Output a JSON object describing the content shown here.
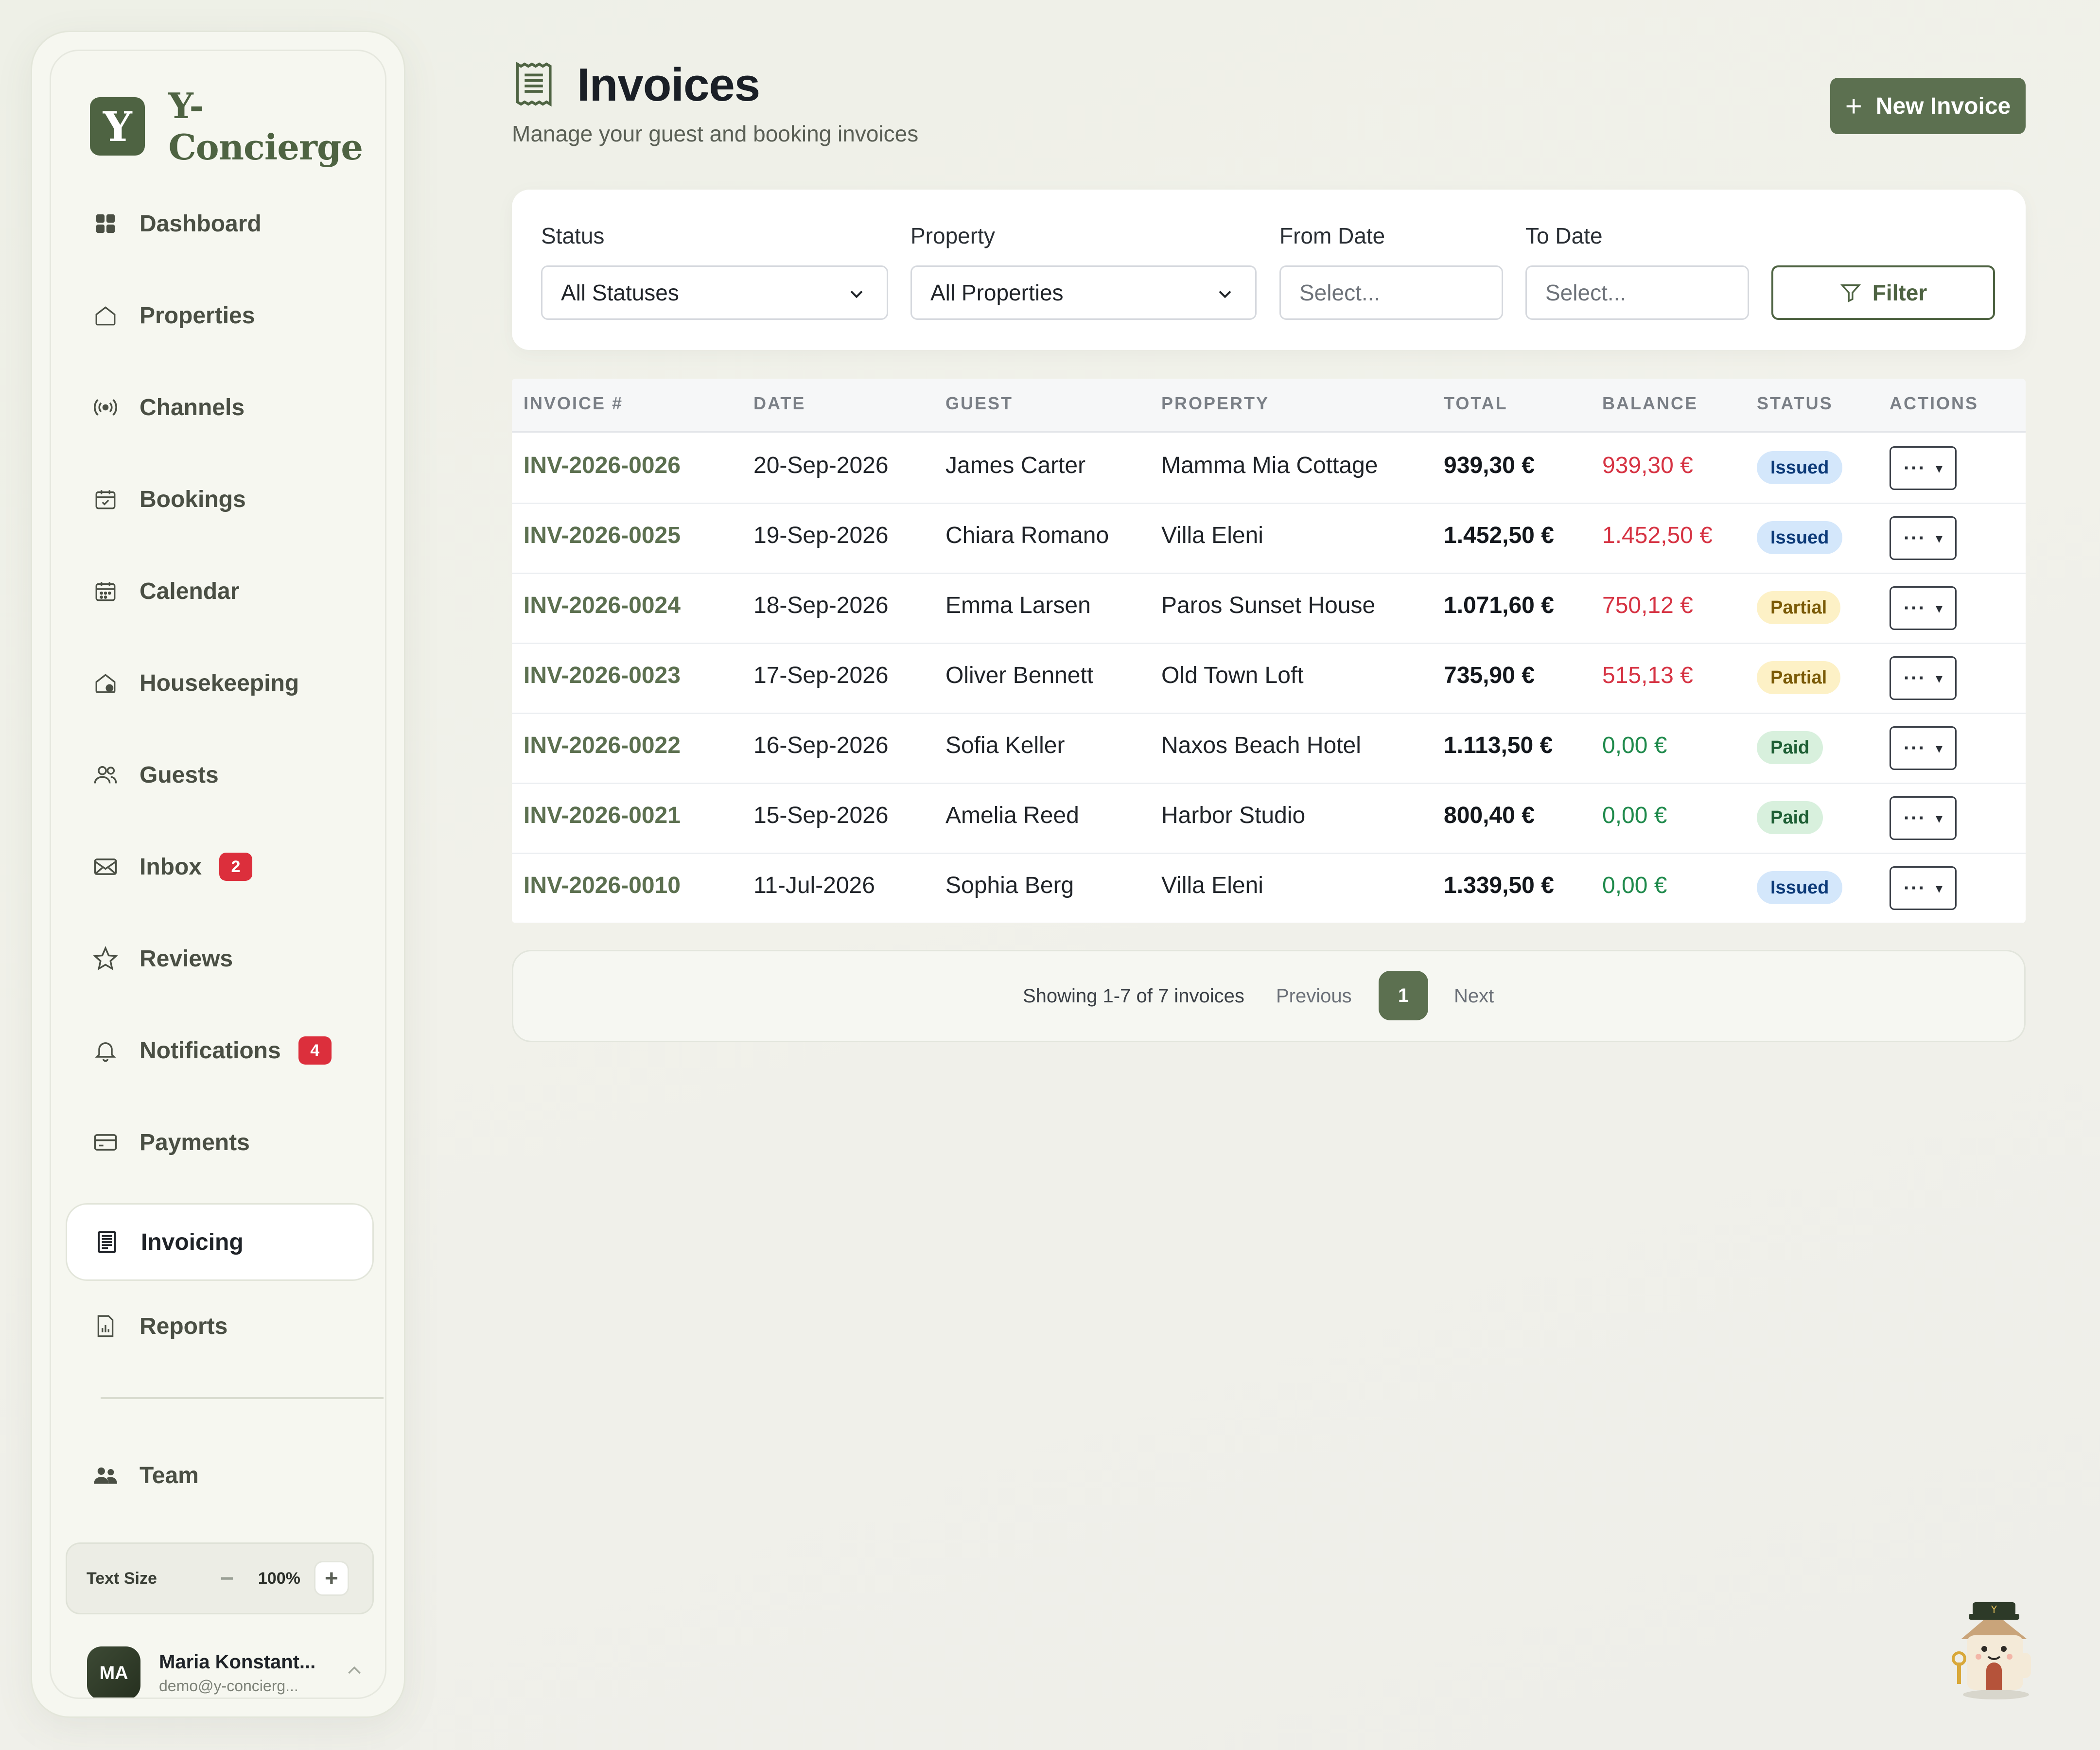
{
  "brand": {
    "logo_letter": "Y",
    "name": "Y-Concierge"
  },
  "sidebar": {
    "items": [
      {
        "label": "Dashboard",
        "icon": "grid-icon"
      },
      {
        "label": "Properties",
        "icon": "house-icon"
      },
      {
        "label": "Channels",
        "icon": "broadcast-icon"
      },
      {
        "label": "Bookings",
        "icon": "calendar-check-icon"
      },
      {
        "label": "Calendar",
        "icon": "calendar-icon"
      },
      {
        "label": "Housekeeping",
        "icon": "house-clean-icon"
      },
      {
        "label": "Guests",
        "icon": "users-icon"
      },
      {
        "label": "Inbox",
        "icon": "mail-icon",
        "badge": "2"
      },
      {
        "label": "Reviews",
        "icon": "star-icon"
      },
      {
        "label": "Notifications",
        "icon": "bell-icon",
        "badge": "4"
      },
      {
        "label": "Payments",
        "icon": "credit-card-icon"
      },
      {
        "label": "Invoicing",
        "icon": "receipt-icon",
        "active": true
      },
      {
        "label": "Reports",
        "icon": "report-icon"
      },
      {
        "label": "Team",
        "icon": "team-icon"
      }
    ],
    "text_size": {
      "label": "Text Size",
      "value": "100%",
      "minus": "−",
      "plus": "+"
    },
    "user": {
      "initials": "MA",
      "name": "Maria Konstant...",
      "email": "demo@y-concierg...",
      "chevron": "^"
    }
  },
  "header": {
    "title": "Invoices",
    "subtitle": "Manage your guest and booking invoices",
    "new_button": "New Invoice",
    "new_button_plus": "+"
  },
  "filters": {
    "status": {
      "label": "Status",
      "value": "All Statuses"
    },
    "property": {
      "label": "Property",
      "value": "All Properties"
    },
    "from_date": {
      "label": "From Date",
      "placeholder": "Select..."
    },
    "to_date": {
      "label": "To Date",
      "placeholder": "Select..."
    },
    "button": "Filter"
  },
  "table": {
    "columns": [
      "INVOICE #",
      "DATE",
      "GUEST",
      "PROPERTY",
      "TOTAL",
      "BALANCE",
      "STATUS",
      "ACTIONS"
    ],
    "rows": [
      {
        "invoice": "INV-2026-0026",
        "date": "20-Sep-2026",
        "guest": "James Carter",
        "property": "Mamma Mia Cottage",
        "total": "939,30 €",
        "balance": "939,30 €",
        "balance_kind": "due",
        "status": "Issued"
      },
      {
        "invoice": "INV-2026-0025",
        "date": "19-Sep-2026",
        "guest": "Chiara Romano",
        "property": "Villa Eleni",
        "total": "1.452,50 €",
        "balance": "1.452,50 €",
        "balance_kind": "due",
        "status": "Issued"
      },
      {
        "invoice": "INV-2026-0024",
        "date": "18-Sep-2026",
        "guest": "Emma Larsen",
        "property": "Paros Sunset House",
        "total": "1.071,60 €",
        "balance": "750,12 €",
        "balance_kind": "due",
        "status": "Partial"
      },
      {
        "invoice": "INV-2026-0023",
        "date": "17-Sep-2026",
        "guest": "Oliver Bennett",
        "property": "Old Town Loft",
        "total": "735,90 €",
        "balance": "515,13 €",
        "balance_kind": "due",
        "status": "Partial"
      },
      {
        "invoice": "INV-2026-0022",
        "date": "16-Sep-2026",
        "guest": "Sofia Keller",
        "property": "Naxos Beach Hotel",
        "total": "1.113,50 €",
        "balance": "0,00 €",
        "balance_kind": "settled",
        "status": "Paid"
      },
      {
        "invoice": "INV-2026-0021",
        "date": "15-Sep-2026",
        "guest": "Amelia Reed",
        "property": "Harbor Studio",
        "total": "800,40 €",
        "balance": "0,00 €",
        "balance_kind": "settled",
        "status": "Paid"
      },
      {
        "invoice": "INV-2026-0010",
        "date": "11-Jul-2026",
        "guest": "Sophia Berg",
        "property": "Villa Eleni",
        "total": "1.339,50 €",
        "balance": "0,00 €",
        "balance_kind": "settled",
        "status": "Issued"
      }
    ],
    "action_dots": "···",
    "action_caret": "▾"
  },
  "pagination": {
    "summary": "Showing 1-7 of 7 invoices",
    "previous": "Previous",
    "current": "1",
    "next": "Next"
  },
  "colors": {
    "accent": "#5c7050",
    "danger": "#d63343",
    "success": "#1f8a4c",
    "badge": "#dc2f3c"
  }
}
